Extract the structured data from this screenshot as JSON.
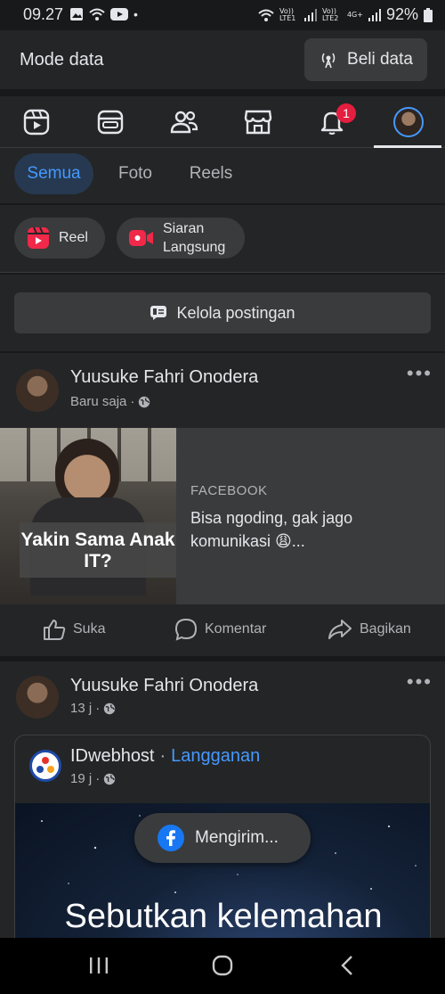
{
  "status_bar": {
    "time": "09.27",
    "battery_percent": "92%",
    "sim1_label": "Vo)) LTE1",
    "sim2_label": "Vo)) LTE2",
    "sim2_network": "4G+"
  },
  "mode_bar": {
    "title": "Mode data",
    "button_label": "Beli data"
  },
  "nav": {
    "items": [
      "home",
      "watch",
      "news-feed",
      "friends",
      "marketplace",
      "notifications",
      "profile"
    ],
    "notification_count": "1"
  },
  "filters": {
    "tabs": [
      "Semua",
      "Foto",
      "Reels"
    ],
    "active": "Semua"
  },
  "create": {
    "reel_label": "Reel",
    "live_label_line1": "Siaran",
    "live_label_line2": "Langsung"
  },
  "manage": {
    "label": "Kelola postingan"
  },
  "post1": {
    "author": "Yuusuke Fahri Onodera",
    "time": "Baru saja",
    "thumb_caption": "Yakin Sama Anak IT?",
    "link_source": "FACEBOOK",
    "link_text": "Bisa ngoding, gak jago komunikasi 😩...",
    "actions": [
      "Suka",
      "Komentar",
      "Bagikan"
    ]
  },
  "post2": {
    "author": "Yuusuke Fahri Onodera",
    "time": "13 j",
    "shared": {
      "page_name": "IDwebhost",
      "separator": "·",
      "subscribe": "Langganan",
      "time": "19 j",
      "headline": "Sebutkan kelemahan"
    }
  },
  "toast": {
    "label": "Mengirim..."
  },
  "colors": {
    "background": "#18191a",
    "card": "#242526",
    "accent": "#4599ff",
    "badge": "#e41e3f"
  }
}
